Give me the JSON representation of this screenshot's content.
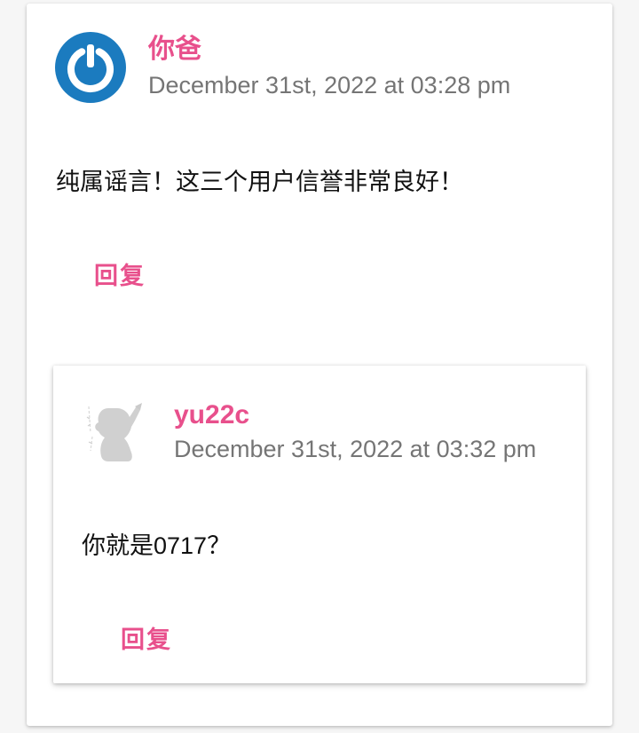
{
  "colors": {
    "accent": "#e8508c",
    "avatar_blue": "#1b7bbf",
    "muted_text": "#757575"
  },
  "comment": {
    "author": "你爸",
    "date": "December 31st, 2022 at 03:28 pm",
    "text": "纯属谣言！这三个用户信誉非常良好！",
    "reply_label": "回复",
    "avatar_icon": "power-logo-avatar-icon"
  },
  "reply": {
    "author": "yu22c",
    "date": "December 31st, 2022 at 03:32 pm",
    "text": "你就是0717？",
    "reply_label": "回复",
    "avatar_icon": "anime-silhouette-avatar-icon"
  }
}
